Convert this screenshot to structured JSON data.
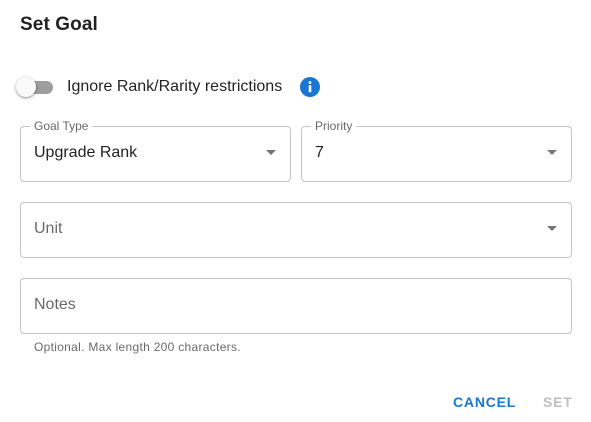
{
  "dialog": {
    "title": "Set Goal"
  },
  "toggle": {
    "label": "Ignore Rank/Rarity restrictions",
    "checked": false
  },
  "goal_type": {
    "label": "Goal Type",
    "value": "Upgrade Rank"
  },
  "priority": {
    "label": "Priority",
    "value": "7"
  },
  "unit": {
    "placeholder": "Unit"
  },
  "notes": {
    "placeholder": "Notes",
    "helper": "Optional. Max length 200 characters."
  },
  "actions": {
    "cancel_label": "CANCEL",
    "set_label": "SET"
  },
  "colors": {
    "primary": "#1976d2",
    "info_icon": "#1976d2",
    "disabled_text": "#bdbdbd"
  }
}
